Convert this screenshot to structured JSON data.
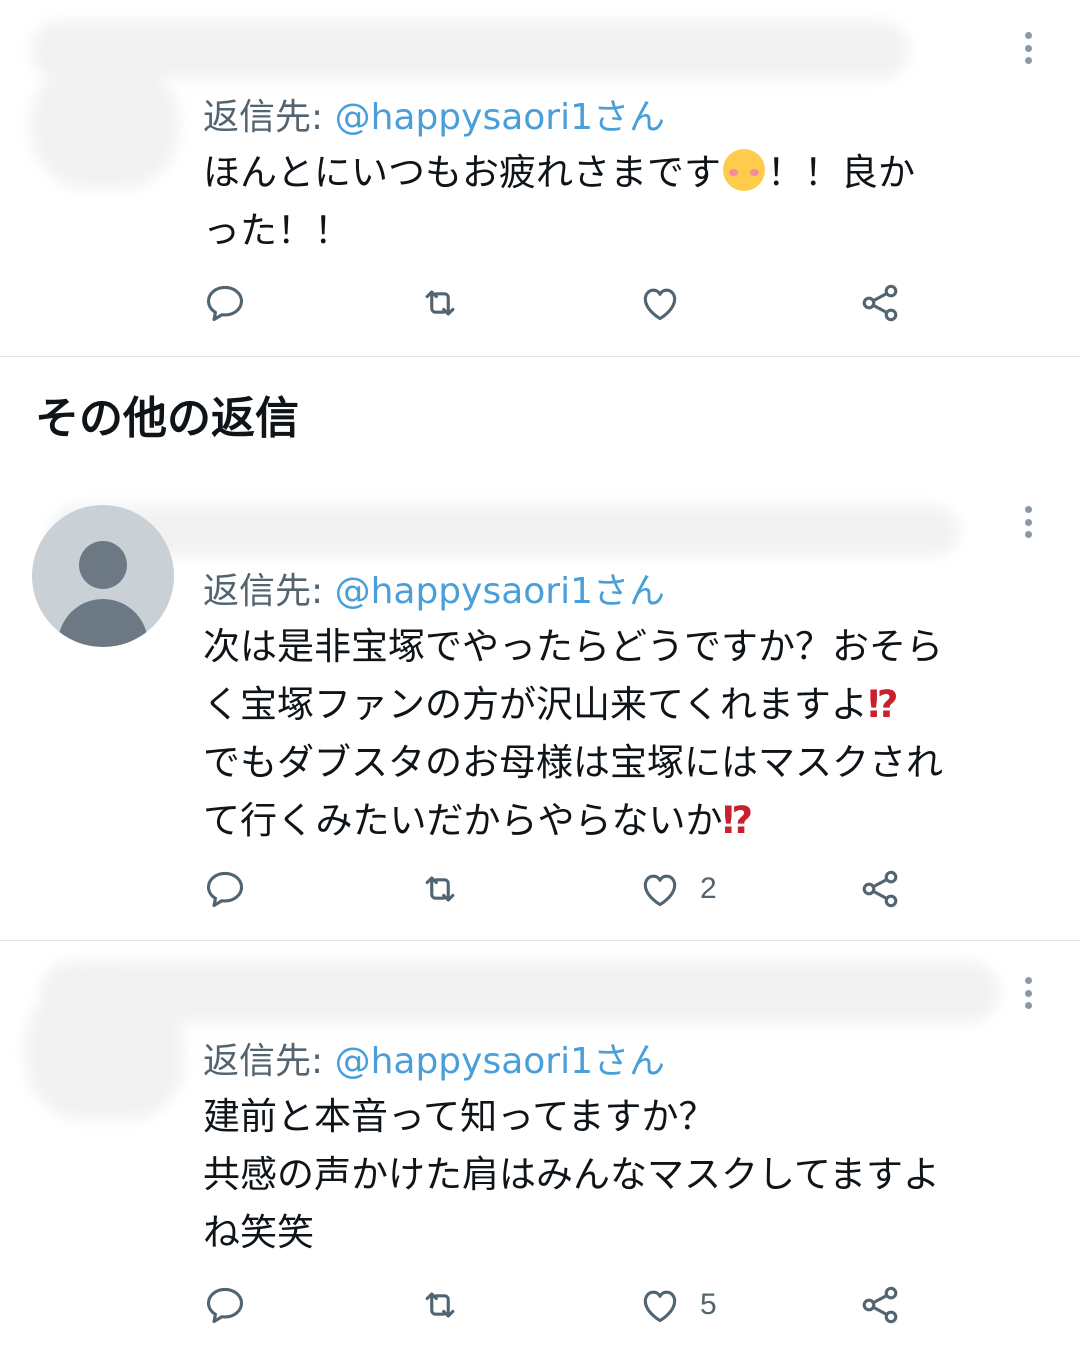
{
  "section_title": "その他の返信",
  "tweets": [
    {
      "reply_prefix": "返信先: ",
      "reply_handle": "@happysaori1さん",
      "text_before_emoji": "ほんとにいつもお疲れさまです",
      "emoji": "smiling-face-with-blush",
      "text_after_emoji": "！！良か",
      "text_line2": "った！！",
      "like_count": ""
    },
    {
      "reply_prefix": "返信先: ",
      "reply_handle": "@happysaori1さん",
      "line1": "次は是非宝塚でやったらどうですか？おそら",
      "line2": "く宝塚ファンの方が沢山来てくれますよ",
      "line3": "でもダブスタのお母様は宝塚にはマスクされ",
      "line4": "て行くみたいだからやらないか",
      "interrobang": "⁉",
      "like_count": "2"
    },
    {
      "reply_prefix": "返信先: ",
      "reply_handle": "@happysaori1さん",
      "line1": "建前と本音って知ってますか？",
      "line2": "共感の声かけた肩はみんなマスクしてますよ",
      "line3": "ね笑笑",
      "like_count": "5"
    }
  ],
  "icons": {
    "reply": "reply-icon",
    "retweet": "retweet-icon",
    "like": "like-icon",
    "share": "share-icon",
    "more": "more-icon"
  },
  "colors": {
    "mention": "#4a9fd8",
    "icon": "#536471",
    "interrobang": "#c8202c"
  }
}
